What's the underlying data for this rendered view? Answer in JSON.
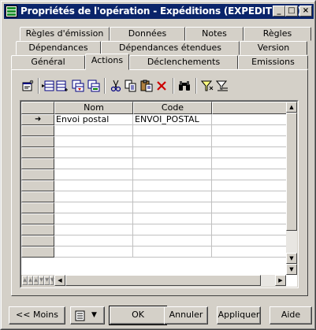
{
  "window": {
    "title": "Propriétés de l'opération - Expéditions (EXPEDITIONS)",
    "caption_buttons": [
      "_",
      "□",
      "×"
    ]
  },
  "tabs": {
    "row1": [
      "Règles d'émission",
      "Données",
      "Notes",
      "Règles"
    ],
    "row2": [
      "Dépendances",
      "Dépendances étendues",
      "Version"
    ],
    "row3": [
      "Général",
      "Actions",
      "Déclenchements",
      "Emissions"
    ],
    "active": "Actions"
  },
  "toolbar": {
    "icons": [
      "properties-icon",
      "insert-row-icon",
      "add-row-icon",
      "add-objects-icon",
      "create-object-icon",
      "cut-icon",
      "copy-icon",
      "paste-icon",
      "delete-icon",
      "find-icon",
      "filter-icon",
      "clear-filter-icon"
    ]
  },
  "grid": {
    "columns": [
      "Nom",
      "Code"
    ],
    "rows": [
      {
        "marker": "➜",
        "nom": "Envoi postal",
        "code": "ENVOI_POSTAL"
      }
    ],
    "empty_rows": 12
  },
  "footer": {
    "less_label": "<< Moins",
    "ok_label": "OK",
    "cancel_label": "Annuler",
    "apply_label": "Appliquer",
    "help_label": "Aide"
  },
  "colors": {
    "titlebar": "#0a246a",
    "face": "#d4d0c8",
    "delete_red": "#cc0000"
  }
}
